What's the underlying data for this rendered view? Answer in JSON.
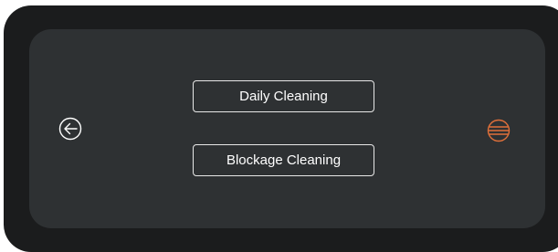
{
  "buttons": {
    "daily_cleaning": "Daily Cleaning",
    "blockage_cleaning": "Blockage Cleaning"
  },
  "icons": {
    "back": "circle-arrow-left-icon",
    "menu": "circle-lines-icon"
  },
  "colors": {
    "bezel": "#1b1c1d",
    "screen": "#2e3133",
    "text": "#ffffff",
    "accent": "#e0703a"
  }
}
